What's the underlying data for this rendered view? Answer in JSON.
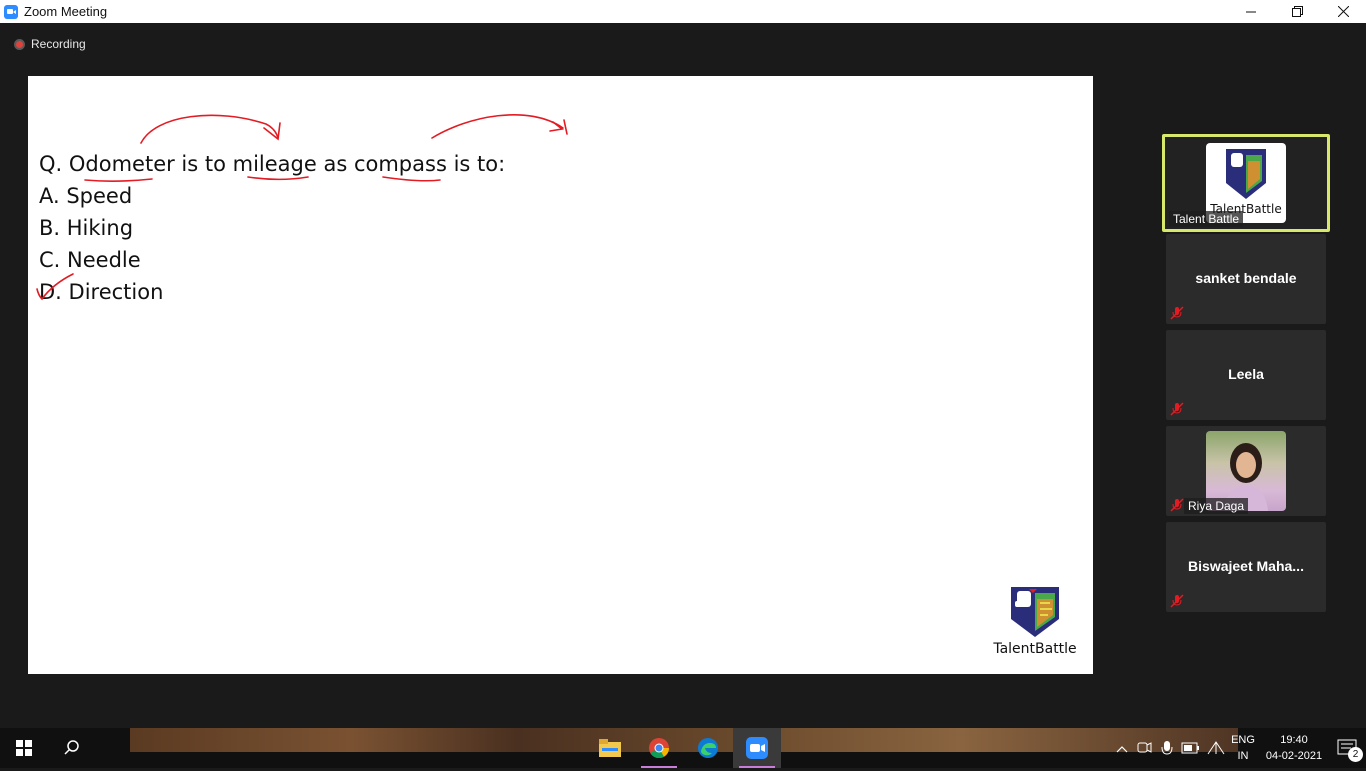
{
  "window": {
    "title": "Zoom Meeting",
    "icon": "zoom-icon",
    "controls": [
      "minimize-icon",
      "restore-icon",
      "close-icon"
    ]
  },
  "recording": {
    "label": "Recording",
    "color": "#e0413a"
  },
  "shared_screen": {
    "question": "Q. Odometer is to mileage as compass is to:",
    "options": [
      "A. Speed",
      "B. Hiking",
      "C. Needle",
      "D. Direction"
    ],
    "annotation_color": "#e31b23",
    "logo_text": "TalentBattle"
  },
  "participants": [
    {
      "name": "Talent Battle",
      "type": "logo",
      "active": true,
      "logo_text": "TalentBattle",
      "highlight_color": "#d8e86a"
    },
    {
      "name": "sanket bendale",
      "type": "name",
      "muted": true
    },
    {
      "name": "Leela",
      "type": "name",
      "muted": true
    },
    {
      "name": "Riya Daga",
      "type": "photo",
      "muted": true
    },
    {
      "name": "Biswajeet  Maha...",
      "type": "name",
      "muted": true
    }
  ],
  "taskbar": {
    "apps": [
      "file-explorer-icon",
      "chrome-icon",
      "edge-icon",
      "zoom-icon"
    ],
    "language": [
      "ENG",
      "IN"
    ],
    "time": "19:40",
    "date": "04-02-2021",
    "notifications": "2"
  }
}
